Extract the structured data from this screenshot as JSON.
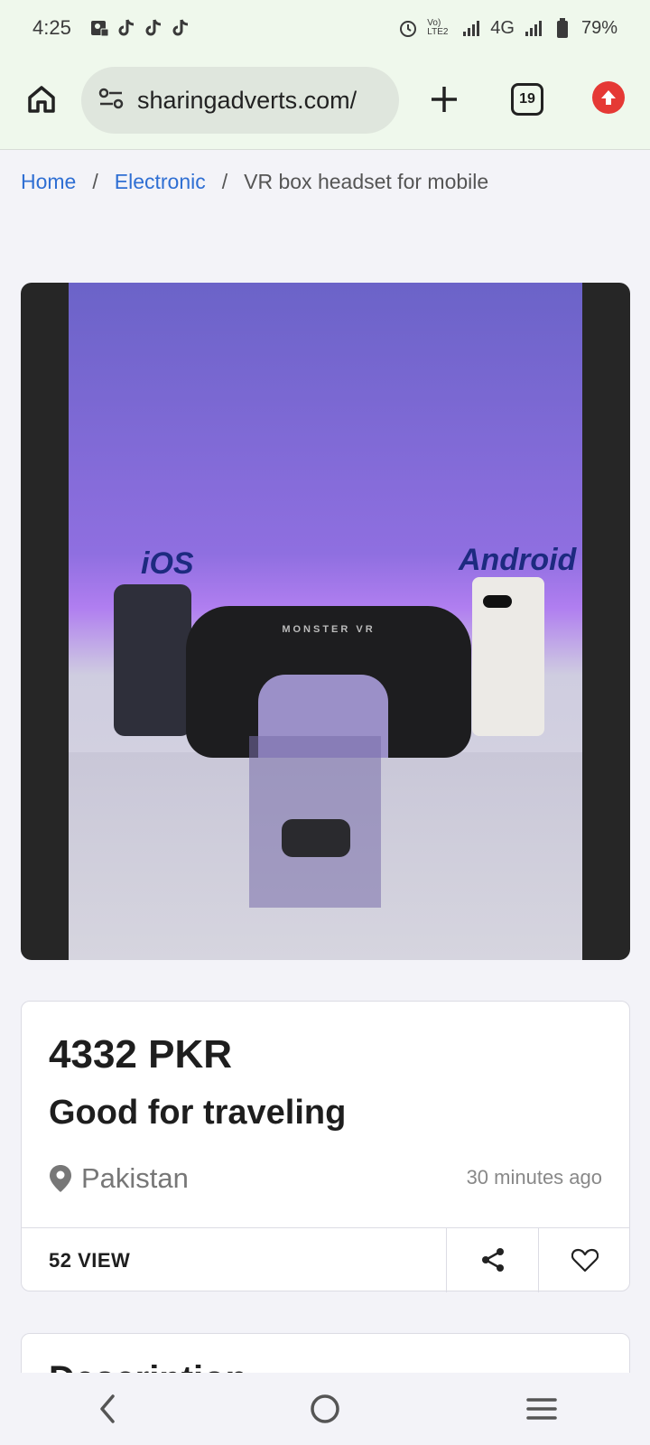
{
  "status_bar": {
    "time": "4:25",
    "network": "4G",
    "battery": "79%",
    "volte": "Vo) LTE2"
  },
  "browser": {
    "url": "sharingadverts.com/",
    "tab_count": "19"
  },
  "breadcrumb": {
    "home": "Home",
    "separator": "/",
    "category": "Electronic",
    "current": "VR box headset for mobile"
  },
  "product_image": {
    "label_left": "iOS",
    "label_right": "Android",
    "headset_brand": "MONSTER VR"
  },
  "listing": {
    "price": "4332 PKR",
    "title": "Good for traveling",
    "location": "Pakistan",
    "posted": "30 minutes ago",
    "views": "52 VIEW"
  },
  "description": {
    "heading": "Description"
  },
  "colors": {
    "link": "#2f6fd3",
    "update_badge": "#e53935",
    "browser_bg": "#eff8ec"
  }
}
